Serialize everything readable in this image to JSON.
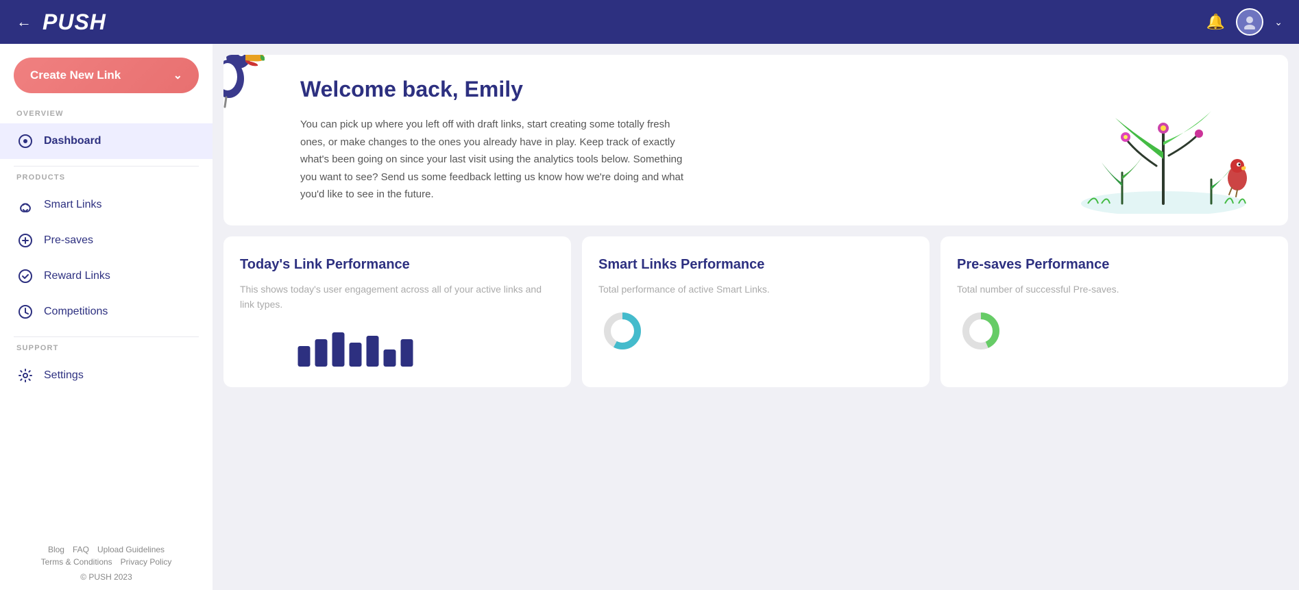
{
  "topnav": {
    "back_label": "←",
    "logo": "PUSH",
    "bell_icon": "🔔",
    "chevron_icon": "⌄"
  },
  "sidebar": {
    "create_button_label": "Create New Link",
    "create_button_chevron": "⌄",
    "overview_label": "OVERVIEW",
    "products_label": "PRODUCTS",
    "support_label": "SUPPORT",
    "nav_items": [
      {
        "id": "dashboard",
        "label": "Dashboard",
        "active": true
      },
      {
        "id": "smart-links",
        "label": "Smart Links",
        "active": false
      },
      {
        "id": "pre-saves",
        "label": "Pre-saves",
        "active": false
      },
      {
        "id": "reward-links",
        "label": "Reward Links",
        "active": false
      },
      {
        "id": "competitions",
        "label": "Competitions",
        "active": false
      },
      {
        "id": "settings",
        "label": "Settings",
        "active": false
      }
    ],
    "footer_links": [
      "Blog",
      "FAQ",
      "Upload Guidelines",
      "Terms & Conditions",
      "Privacy Policy"
    ],
    "copyright": "© PUSH 2023"
  },
  "welcome": {
    "title": "Welcome back, Emily",
    "body": "You can pick up where you left off with draft links, start creating some totally fresh ones, or make changes to the ones you already have in play. Keep track of exactly what's been going on since your last visit using the analytics tools below. Something you want to see? Send us some feedback letting us know how we're doing and what you'd like to see in the future."
  },
  "cards": [
    {
      "id": "today-link-performance",
      "title": "Today's Link Performance",
      "subtitle": "This shows today's user engagement across all of your active links and link types."
    },
    {
      "id": "smart-links-performance",
      "title": "Smart Links Performance",
      "subtitle": "Total performance of active Smart Links."
    },
    {
      "id": "pre-saves-performance",
      "title": "Pre-saves Performance",
      "subtitle": "Total number of successful Pre-saves."
    }
  ]
}
